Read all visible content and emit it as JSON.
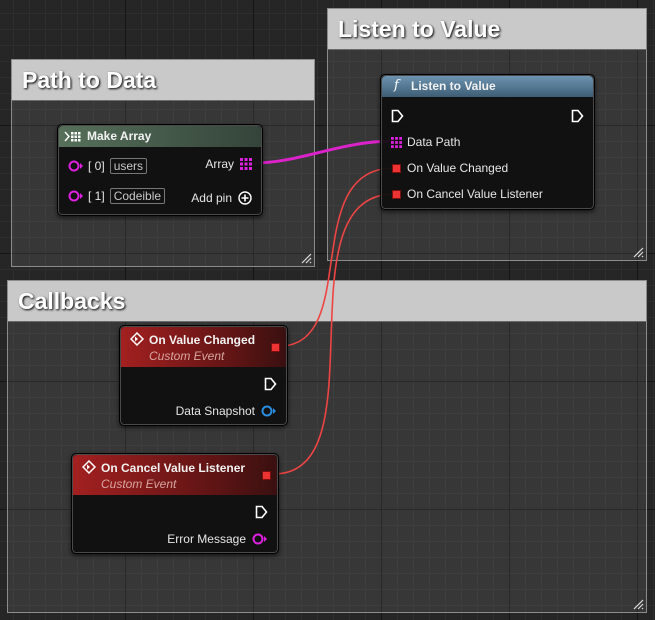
{
  "comments": {
    "path_to_data": {
      "title": "Path to Data"
    },
    "listen_to_value": {
      "title": "Listen to Value"
    },
    "callbacks": {
      "title": "Callbacks"
    }
  },
  "nodes": {
    "make_array": {
      "title": "Make Array",
      "header_color": "#3b4b3a",
      "inputs": [
        {
          "index": "[ 0]",
          "value": "users"
        },
        {
          "index": "[ 1]",
          "value": "Codeible"
        }
      ],
      "output_label": "Array",
      "add_pin_label": "Add pin"
    },
    "listen_to_value": {
      "title": "Listen to Value",
      "header_color": "#4a6a80",
      "function_glyph": "f",
      "inputs": [
        "Data Path",
        "On Value Changed",
        "On Cancel Value Listener"
      ]
    },
    "on_value_changed": {
      "title": "On Value Changed",
      "subtitle": "Custom Event",
      "header_color": "#8a1a1a",
      "output_label": "Data Snapshot"
    },
    "on_cancel_value_listener": {
      "title": "On Cancel Value Listener",
      "subtitle": "Custom Event",
      "header_color": "#8a1a1a",
      "output_label": "Error Message"
    }
  },
  "colors": {
    "wire_array": "#dd22cc",
    "wire_delegate": "#ee4444",
    "pin_string": "#e020e0",
    "pin_struct": "#2a8de0",
    "pin_delegate": "#ee3333",
    "exec": "#ffffff"
  }
}
